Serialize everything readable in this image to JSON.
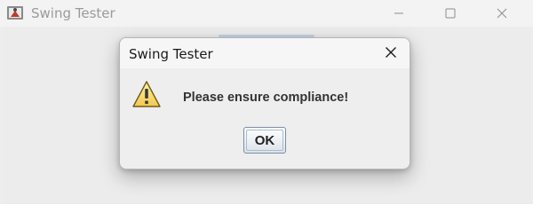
{
  "main_window": {
    "title": "Swing Tester",
    "icon": "java-cup-icon",
    "controls": [
      "minimize-icon",
      "maximize-icon",
      "close-icon"
    ]
  },
  "dialog": {
    "title": "Swing Tester",
    "message": "Please ensure compliance!",
    "icon": "warning-icon",
    "ok_label": "OK",
    "close_icon": "close-icon"
  }
}
